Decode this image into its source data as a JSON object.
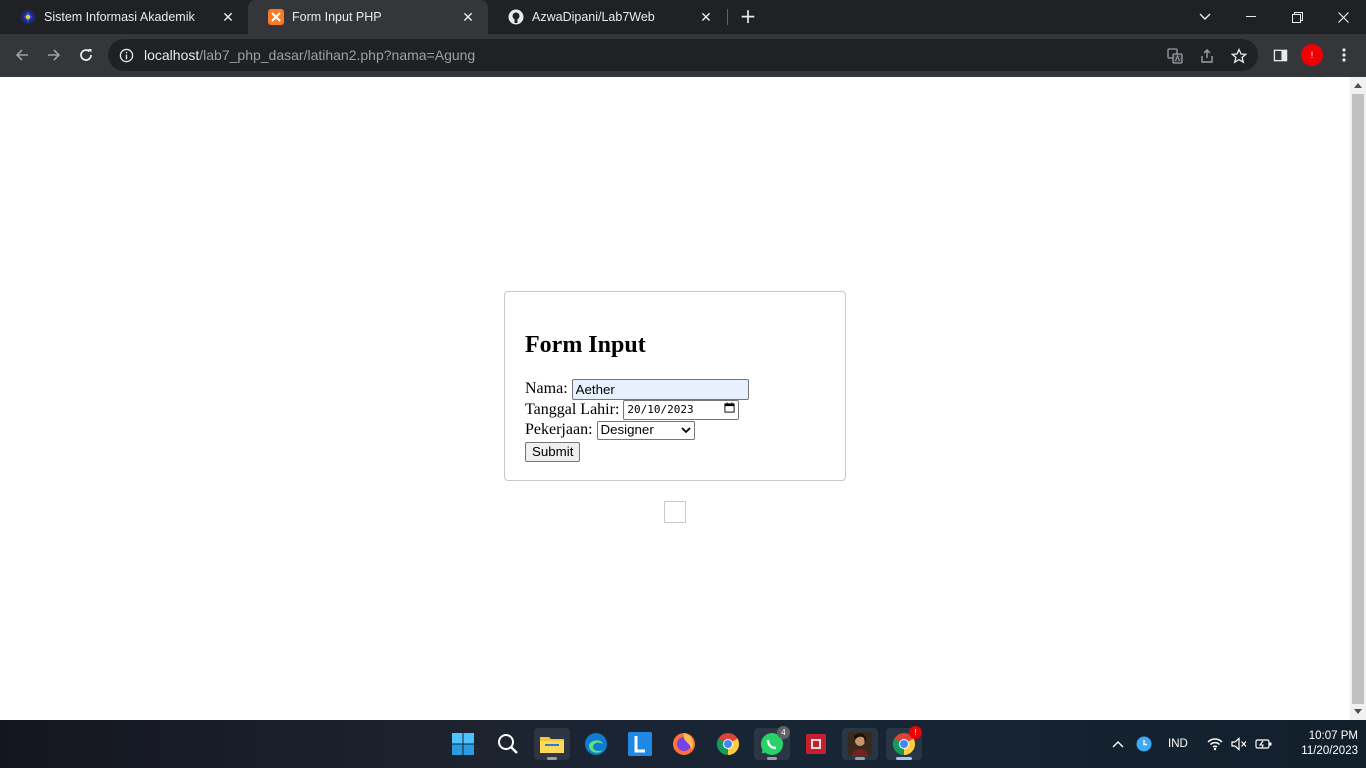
{
  "browser": {
    "tabs": [
      {
        "title": "Sistem Informasi Akademik",
        "icon": "academic-logo-icon",
        "active": false
      },
      {
        "title": "Form Input PHP",
        "icon": "xampp-icon",
        "active": true
      },
      {
        "title": "AzwaDipani/Lab7Web",
        "icon": "github-icon",
        "active": false
      }
    ],
    "url": {
      "host": "localhost",
      "path": "/lab7_php_dasar/latihan2.php?nama=Agung"
    },
    "profile_badge": "!",
    "accent_color": "#35363a"
  },
  "form": {
    "heading": "Form Input",
    "nama_label": "Nama:",
    "nama_value": "Aether",
    "tanggal_label": "Tanggal Lahir:",
    "tanggal_value": "20/10/2023",
    "pekerjaan_label": "Pekerjaan:",
    "pekerjaan_value": "Designer",
    "submit_label": "Submit"
  },
  "taskbar": {
    "apps": [
      {
        "name": "windows-start-icon"
      },
      {
        "name": "search-icon"
      },
      {
        "name": "file-explorer-icon",
        "running": true
      },
      {
        "name": "edge-icon"
      },
      {
        "name": "l-app-icon"
      },
      {
        "name": "firefox-icon"
      },
      {
        "name": "chrome-icon"
      },
      {
        "name": "whatsapp-icon",
        "badge": "4",
        "running": true
      },
      {
        "name": "red-app-icon"
      },
      {
        "name": "game-icon",
        "running": true
      },
      {
        "name": "chrome-profile-icon",
        "badge": "!",
        "running": true,
        "active": true
      }
    ],
    "language": "IND",
    "time": "10:07 PM",
    "date": "11/20/2023"
  }
}
